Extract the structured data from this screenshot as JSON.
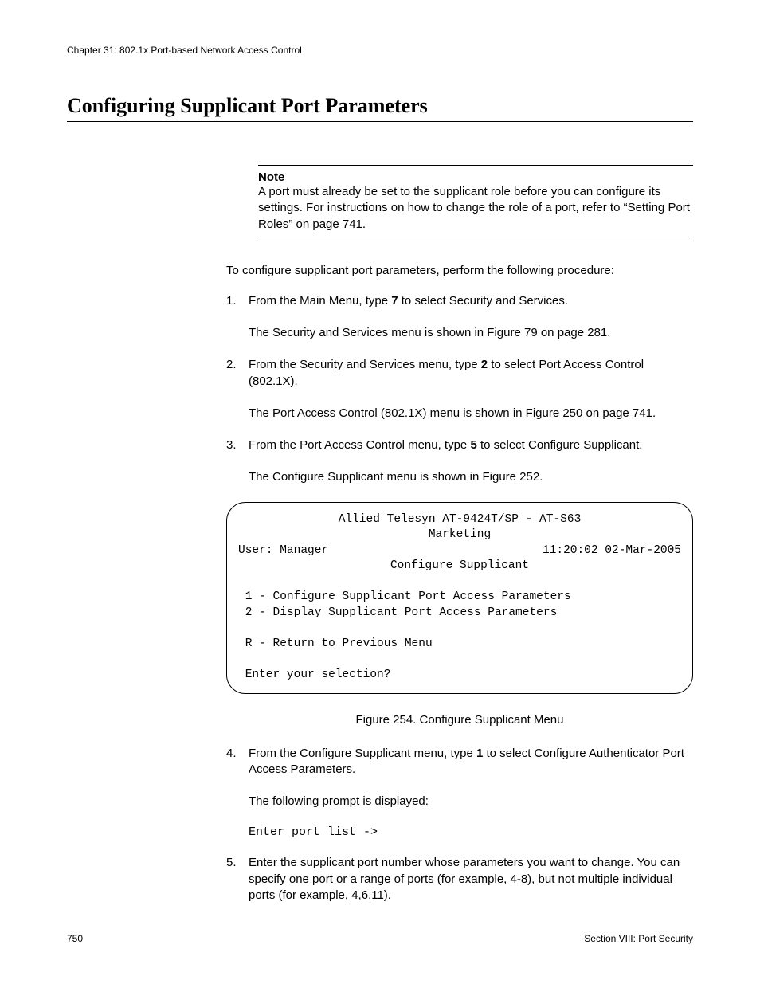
{
  "chapter_header": "Chapter 31: 802.1x Port-based Network Access Control",
  "section_title": "Configuring Supplicant Port Parameters",
  "note": {
    "label": "Note",
    "text": "A port must already be set to the supplicant role before you can configure its settings. For instructions on how to change the role of a port, refer to “Setting Port Roles” on page 741."
  },
  "intro": "To configure supplicant port parameters, perform the following procedure:",
  "steps": {
    "s1": {
      "num": "1.",
      "text_a": "From the Main Menu, type ",
      "bold": "7",
      "text_b": " to select Security and Services.",
      "result": "The Security and Services menu is shown in Figure 79 on page 281."
    },
    "s2": {
      "num": "2.",
      "text_a": "From the Security and Services menu, type ",
      "bold": "2",
      "text_b": " to select Port Access Control (802.1X).",
      "result": "The Port Access Control (802.1X) menu is shown in Figure 250 on page 741."
    },
    "s3": {
      "num": "3.",
      "text_a": "From the Port Access Control menu, type ",
      "bold": "5",
      "text_b": " to select Configure Supplicant.",
      "result": "The Configure Supplicant menu is shown in Figure 252."
    },
    "s4": {
      "num": "4.",
      "text_a": "From the Configure Supplicant menu, type ",
      "bold": "1",
      "text_b": " to select Configure Authenticator Port Access Parameters.",
      "result": "The following prompt is displayed:",
      "prompt": "Enter port list ->"
    },
    "s5": {
      "num": "5.",
      "text": "Enter the supplicant port number whose parameters you want to change. You can specify one port or a range of ports (for example, 4-8), but not multiple individual ports (for example, 4,6,11)."
    }
  },
  "terminal": {
    "line1": "Allied Telesyn AT-9424T/SP - AT-S63",
    "line2": "Marketing",
    "user_label": "User: Manager",
    "timestamp": "11:20:02 02-Mar-2005",
    "menu_title": "Configure Supplicant",
    "opt1": " 1 - Configure Supplicant Port Access Parameters",
    "opt2": " 2 - Display Supplicant Port Access Parameters",
    "optR": " R - Return to Previous Menu",
    "prompt": " Enter your selection?"
  },
  "figure_caption": "Figure 254. Configure Supplicant Menu",
  "footer": {
    "page_num": "750",
    "section": "Section VIII: Port Security"
  }
}
